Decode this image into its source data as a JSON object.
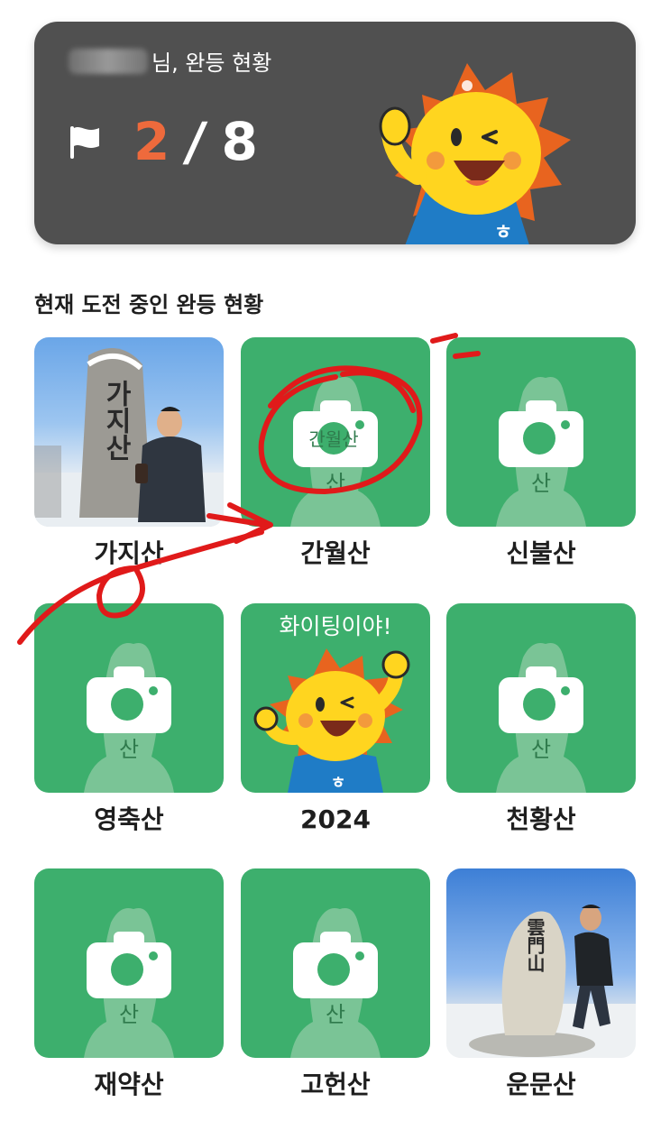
{
  "hero": {
    "greeting_suffix": "님, 완등 현황",
    "completed": "2",
    "separator": "/",
    "total": "8",
    "accent_color": "#ee6a3c"
  },
  "section": {
    "title": "현재 도전 중인 완등 현황"
  },
  "mountains": [
    {
      "name": "가지산",
      "stone_text": "가지산",
      "status": "photo"
    },
    {
      "name": "간월산",
      "stone_text": "간월산",
      "status": "camera"
    },
    {
      "name": "신불산",
      "stone_text": "신불산",
      "status": "camera"
    },
    {
      "name": "영축산",
      "stone_text": "영축산",
      "status": "camera"
    },
    {
      "name": "2024",
      "stone_text": "",
      "status": "mascot",
      "cheer": "화이팅이야!"
    },
    {
      "name": "천황산",
      "stone_text": "천황산",
      "status": "camera"
    },
    {
      "name": "재약산",
      "stone_text": "재약산",
      "status": "camera"
    },
    {
      "name": "고헌산",
      "stone_text": "고헌산",
      "status": "camera"
    },
    {
      "name": "운문산",
      "stone_text": "雲門山",
      "status": "photo"
    }
  ],
  "photo_texts": {
    "gajisan_stone": "가지산",
    "unmunsan_stone": "雲門山"
  },
  "colors": {
    "tile_green": "#3daf6d",
    "hero_bg": "#505050",
    "annotation_red": "#e01a1a"
  },
  "icons": [
    "flag-icon",
    "camera-icon"
  ]
}
